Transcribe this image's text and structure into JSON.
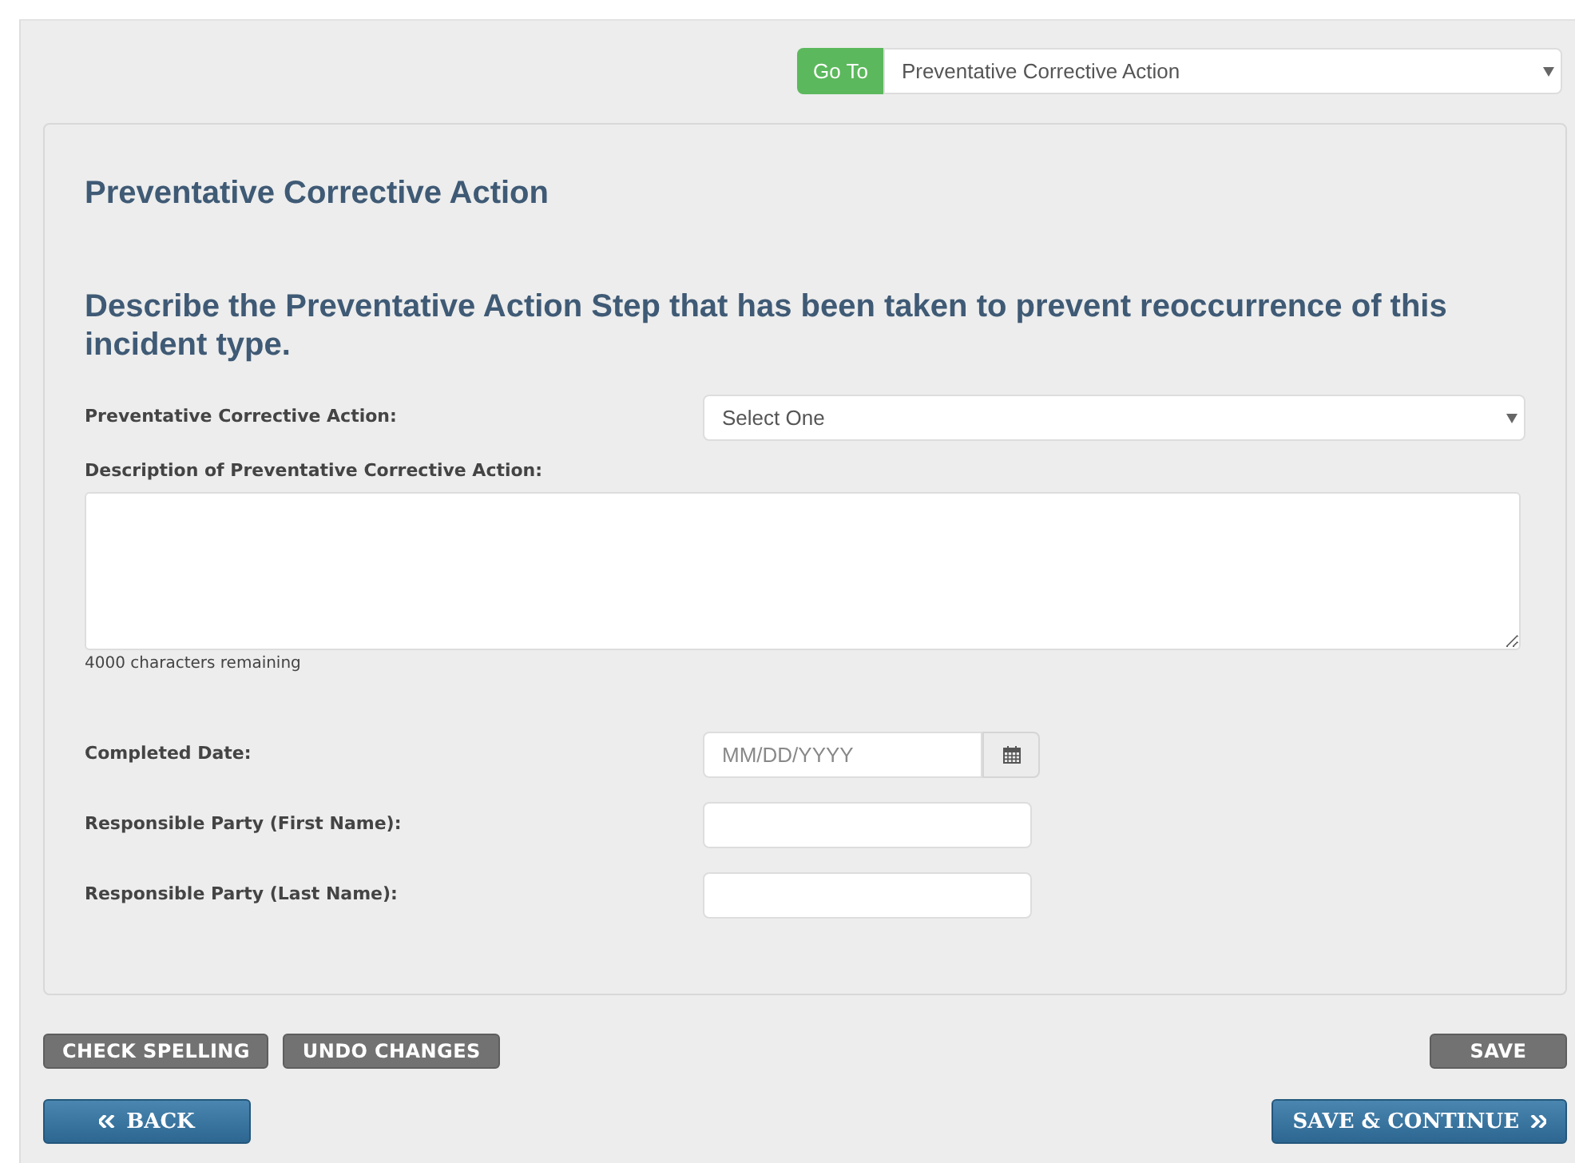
{
  "goto": {
    "button": "Go To",
    "value": "Preventative Corrective Action"
  },
  "section_title": "Preventative Corrective Action",
  "question": "Describe the Preventative Action Step that has been taken to prevent reoccurrence of this incident type.",
  "fields": [
    {
      "kind": "select",
      "label": "Preventative Corrective Action:",
      "value": "Select One"
    },
    {
      "kind": "textarea",
      "label": "Description of Preventative Corrective Action:",
      "counter": "4000 characters remaining"
    },
    {
      "kind": "date",
      "label": "Completed Date:",
      "placeholder": "MM/DD/YYYY"
    },
    {
      "kind": "text",
      "label": "Responsible Party (First Name):"
    },
    {
      "kind": "text",
      "label": "Responsible Party (Last Name):"
    }
  ],
  "tool_buttons": [
    "CHECK SPELLING",
    "UNDO CHANGES"
  ],
  "save_button": "SAVE",
  "back_button": "BACK",
  "continue_button": "SAVE & CONTINUE"
}
